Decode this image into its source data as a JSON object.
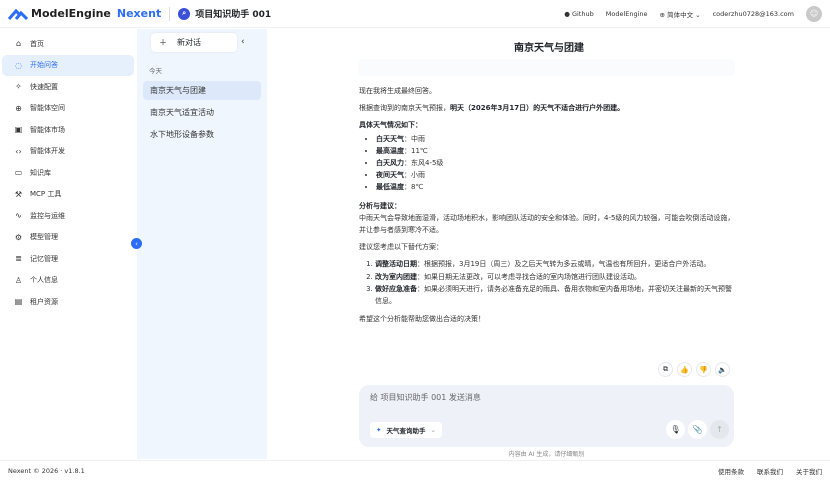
{
  "header": {
    "brand_main": "ModelEngine",
    "brand_accent": "Nexent",
    "agent_name": "项目知识助手 001",
    "links": [
      "Github",
      "ModelEngine"
    ],
    "language": "简体中文",
    "user_email": "coderzhu0728@163.com"
  },
  "sidebar": {
    "items": [
      {
        "label": "首页",
        "icon": "home-icon"
      },
      {
        "label": "开始问答",
        "icon": "chat-icon",
        "active": true
      },
      {
        "label": "快速配置",
        "icon": "sparkle-icon"
      },
      {
        "label": "智能体空间",
        "icon": "globe-icon"
      },
      {
        "label": "智能体市场",
        "icon": "store-icon"
      },
      {
        "label": "智能体开发",
        "icon": "code-icon"
      },
      {
        "label": "知识库",
        "icon": "book-icon"
      },
      {
        "label": "MCP 工具",
        "icon": "tool-icon"
      },
      {
        "label": "监控与运维",
        "icon": "chart-icon"
      },
      {
        "label": "模型管理",
        "icon": "gear-icon"
      },
      {
        "label": "记忆管理",
        "icon": "database-icon"
      },
      {
        "label": "个人信息",
        "icon": "user-icon"
      },
      {
        "label": "租户资源",
        "icon": "building-icon"
      }
    ]
  },
  "conversations": {
    "new_label": "新对话",
    "group": "今天",
    "items": [
      "南京天气与团建",
      "南京天气适宜活动",
      "水下地形设备参数"
    ]
  },
  "chat": {
    "title": "南京天气与团建",
    "intro": "现在我将生成最终回答。",
    "summary_prefix": "根据查询到的南京天气预报，",
    "summary_bold": "明天（2026年3月17日）的天气不适合进行户外团建。",
    "details_title": "具体天气情况如下：",
    "details": [
      {
        "k": "白天天气",
        "v": "：中雨"
      },
      {
        "k": "最高温度",
        "v": "：11℃"
      },
      {
        "k": "白天风力",
        "v": "：东风4-5级"
      },
      {
        "k": "夜间天气",
        "v": "：小雨"
      },
      {
        "k": "最低温度",
        "v": "：8℃"
      }
    ],
    "analysis_title": "分析与建议：",
    "analysis": "中雨天气会导致地面湿滑，活动场地积水，影响团队活动的安全和体验。同时，4-5级的风力较强，可能会吹倒活动设施，并让参与者感到寒冷不适。",
    "alt_intro": "建议您考虑以下替代方案：",
    "alternatives": [
      {
        "k": "调整活动日期",
        "v": "：根据预报，3月19日（周三）及之后天气转为多云或晴，气温也有所回升，更适合户外活动。"
      },
      {
        "k": "改为室内团建",
        "v": "：如果日期无法更改，可以考虑寻找合适的室内场馆进行团队建设活动。"
      },
      {
        "k": "做好应急准备",
        "v": "：如果必须明天进行，请务必准备充足的雨具、备用衣物和室内备用场地，并密切关注最新的天气预警信息。"
      }
    ],
    "closing": "希望这个分析能帮助您做出合适的决策！"
  },
  "input": {
    "placeholder": "给 项目知识助手 001 发送消息",
    "tool": "天气查询助手",
    "disclaimer": "内容由 AI 生成，请仔细甄别"
  },
  "footer": {
    "copyright": "Nexent © 2026 · v1.8.1",
    "links": [
      "使用条款",
      "联系我们",
      "关于我们"
    ]
  },
  "colors": {
    "accent": "#2d6cf6",
    "active_bg": "#e6f0fd",
    "list_bg": "#f0f6fe"
  }
}
